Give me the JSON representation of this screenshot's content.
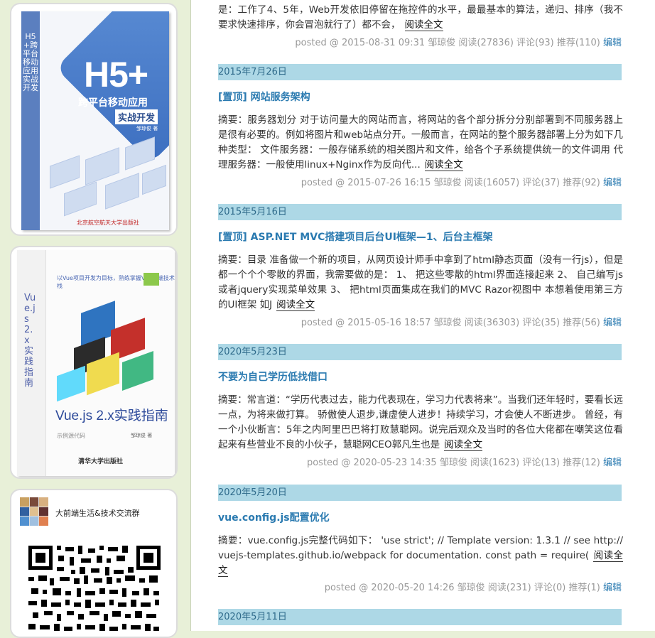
{
  "sidebar": {
    "book1": {
      "big_title": "H5+",
      "subtitle1": "跨平台移动应用",
      "subtitle2": "实战开发",
      "spine": "H5+跨平台移动应用实战开发",
      "author": "邹琼俊 著",
      "publisher": "北京航空航天大学出版社"
    },
    "book2": {
      "tagline": "以Vue项目开发为目标，熟练掌握Vue前端技术栈",
      "spine": "Vue.js 2.x实践指南",
      "title": "Vue.js 2.x实践指南",
      "logo": "示例源代码",
      "author": "邹琼俊 著",
      "publisher": "清华大学出版社"
    },
    "qr_card": {
      "group_name": "大前端生活&技术交流群"
    }
  },
  "main": {
    "top_post": {
      "summary_tail": "是：工作了4、5年，Web开发依旧停留在拖控件的水平，最最基本的算法，递归、排序（我不要求快速排序，你会冒泡就行了）都不会，",
      "read_more": "阅读全文",
      "meta": "posted @ 2015-08-31 09:31 邹琼俊 阅读(27836) 评论(93) 推荐(110)",
      "edit": "编辑"
    },
    "posts": [
      {
        "date": "2015年7月26日",
        "title": "[置顶] 网站服务架构",
        "summary": "摘要：服务器划分 对于访问量大的网站而言，将网站的各个部分拆分分别部署到不同服务器上是很有必要的。例如将图片和web站点分开。一般而言，在网站的整个服务器部署上分为如下几种类型： 文件服务器：一般存储系统的相关图片和文件，给各个子系统提供统一的文件调用 代理服务器：一般使用linux+Nginx作为反向代...",
        "read_more": "阅读全文",
        "meta": "posted @ 2015-07-26 16:15 邹琼俊 阅读(16057) 评论(37) 推荐(92)",
        "edit": "编辑"
      },
      {
        "date": "2015年5月16日",
        "title": "[置顶] ASP.NET MVC搭建项目后台UI框架—1、后台主框架",
        "summary": "摘要：目录 准备做一个新的项目，从网页设计师手中拿到了html静态页面（没有一行js），但是都一个个个零散的界面，我需要做的是： 1、 把这些零散的html界面连接起来 2、 自己编写js或者jquery实现菜单效果 3、 把html页面集成在我们的MVC Razor视图中 本想着使用第三方的UI框架 如J",
        "read_more": "阅读全文",
        "meta": "posted @ 2015-05-16 18:57 邹琼俊 阅读(36303) 评论(35) 推荐(56)",
        "edit": "编辑"
      },
      {
        "date": "2020年5月23日",
        "title": "不要为自己学历低找借口",
        "summary": "摘要：常言道：“学历代表过去，能力代表现在，学习力代表将来”。当我们还年轻时，要看长远一点，为将来做打算。 骄傲使人退步,谦虚使人进步！持续学习，才会使人不断进步。 曾经，有一个小伙断言：5年之内阿里巴巴将打败慧聪网。说完后观众及当时的各位大佬都在嘲笑这位看起来有些营业不良的小伙子，慧聪网CEO郭凡生也是",
        "read_more": "阅读全文",
        "meta": "posted @ 2020-05-23 14:35 邹琼俊 阅读(1623) 评论(13) 推荐(12)",
        "edit": "编辑"
      },
      {
        "date": "2020年5月20日",
        "title": "vue.config.js配置优化",
        "summary": "摘要：vue.config.js完整代码如下： 'use strict'; // Template version: 1.3.1 // see http://vuejs-templates.github.io/webpack for documentation. const path = require(",
        "read_more": "阅读全文",
        "meta": "posted @ 2020-05-20 14:26 邹琼俊 阅读(231) 评论(0) 推荐(1)",
        "edit": "编辑"
      },
      {
        "date": "2020年5月11日"
      }
    ]
  }
}
